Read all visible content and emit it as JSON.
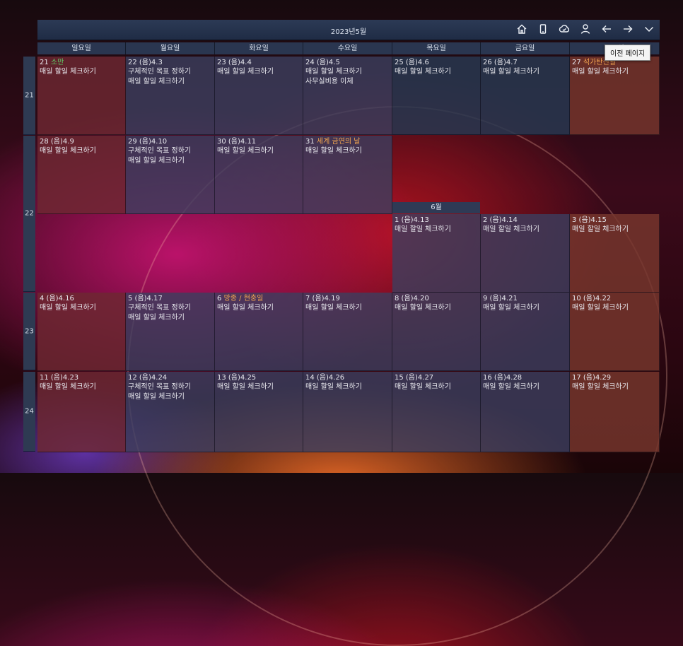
{
  "title": "2023년5월",
  "toolbar": {
    "icons": [
      "home-icon",
      "tablet-icon",
      "cloud-check-icon",
      "person-icon",
      "arrow-left-icon",
      "arrow-right-icon",
      "chevron-down-icon"
    ],
    "tooltip": "이전 페이지"
  },
  "weekdays": [
    "일요일",
    "월요일",
    "화요일",
    "수요일",
    "목요일",
    "금요일",
    "토요일"
  ],
  "weeks": [
    "21",
    "22",
    "23",
    "24"
  ],
  "june_label": "6월",
  "cells": [
    {
      "date": "21",
      "holiday": "소만",
      "holiday_color": "green",
      "events": [
        "매일 할일 체크하기"
      ],
      "tone": "sun"
    },
    {
      "date": "22 (음)4.3",
      "events": [
        "구체적인 목표 정하기",
        "매일 할일 체크하기"
      ],
      "tone": "wk"
    },
    {
      "date": "23 (음)4.4",
      "events": [
        "매일 할일 체크하기"
      ],
      "tone": "wk"
    },
    {
      "date": "24 (음)4.5",
      "events": [
        "매일 할일 체크하기",
        "사무실비용 이체"
      ],
      "tone": "wk"
    },
    {
      "date": "25 (음)4.6",
      "events": [
        "매일 할일 체크하기"
      ],
      "tone": "dk"
    },
    {
      "date": "26 (음)4.7",
      "events": [
        "매일 할일 체크하기"
      ],
      "tone": "dk"
    },
    {
      "date": "27",
      "holiday": "석가탄신일",
      "holiday_color": "orange",
      "events": [
        "매일 할일 체크하기"
      ],
      "tone": "sat"
    },
    {
      "date": "28 (음)4.9",
      "events": [
        "매일 할일 체크하기"
      ],
      "tone": "sun"
    },
    {
      "date": "29 (음)4.10",
      "events": [
        "구체적인 목표 정하기",
        "매일 할일 체크하기"
      ],
      "tone": "wk"
    },
    {
      "date": "30 (음)4.11",
      "events": [
        "매일 할일 체크하기"
      ],
      "tone": "wk"
    },
    {
      "date": "31",
      "holiday": "세계 금연의 날",
      "holiday_color": "orange",
      "events": [
        "매일 할일 체크하기"
      ],
      "tone": "wk"
    },
    {
      "date": "1 (음)4.13",
      "events": [
        "매일 할일 체크하기"
      ],
      "tone": "wk"
    },
    {
      "date": "2 (음)4.14",
      "events": [
        "매일 할일 체크하기"
      ],
      "tone": "wk"
    },
    {
      "date": "3 (음)4.15",
      "events": [
        "매일 할일 체크하기"
      ],
      "tone": "sat"
    },
    {
      "date": "4 (음)4.16",
      "events": [
        "매일 할일 체크하기"
      ],
      "tone": "sun"
    },
    {
      "date": "5 (음)4.17",
      "events": [
        "구체적인 목표 정하기",
        "매일 할일 체크하기"
      ],
      "tone": "wk"
    },
    {
      "date": "6",
      "holiday": "망종 / 현충일",
      "holiday_color": "orange",
      "events": [
        "매일 할일 체크하기"
      ],
      "tone": "wk"
    },
    {
      "date": "7 (음)4.19",
      "events": [
        "매일 할일 체크하기"
      ],
      "tone": "wk"
    },
    {
      "date": "8 (음)4.20",
      "events": [
        "매일 할일 체크하기"
      ],
      "tone": "wk"
    },
    {
      "date": "9 (음)4.21",
      "events": [
        "매일 할일 체크하기"
      ],
      "tone": "wk"
    },
    {
      "date": "10 (음)4.22",
      "events": [
        "매일 할일 체크하기"
      ],
      "tone": "sat"
    },
    {
      "date": "11 (음)4.23",
      "events": [
        "매일 할일 체크하기"
      ],
      "tone": "sun"
    },
    {
      "date": "12 (음)4.24",
      "events": [
        "구체적인 목표 정하기",
        "매일 할일 체크하기"
      ],
      "tone": "wk"
    },
    {
      "date": "13 (음)4.25",
      "events": [
        "매일 할일 체크하기"
      ],
      "tone": "wk"
    },
    {
      "date": "14 (음)4.26",
      "events": [
        "매일 할일 체크하기"
      ],
      "tone": "wk"
    },
    {
      "date": "15 (음)4.27",
      "events": [
        "매일 할일 체크하기"
      ],
      "tone": "wk"
    },
    {
      "date": "16 (음)4.28",
      "events": [
        "매일 할일 체크하기"
      ],
      "tone": "wk"
    },
    {
      "date": "17 (음)4.29",
      "events": [
        "매일 할일 체크하기"
      ],
      "tone": "sat"
    }
  ]
}
